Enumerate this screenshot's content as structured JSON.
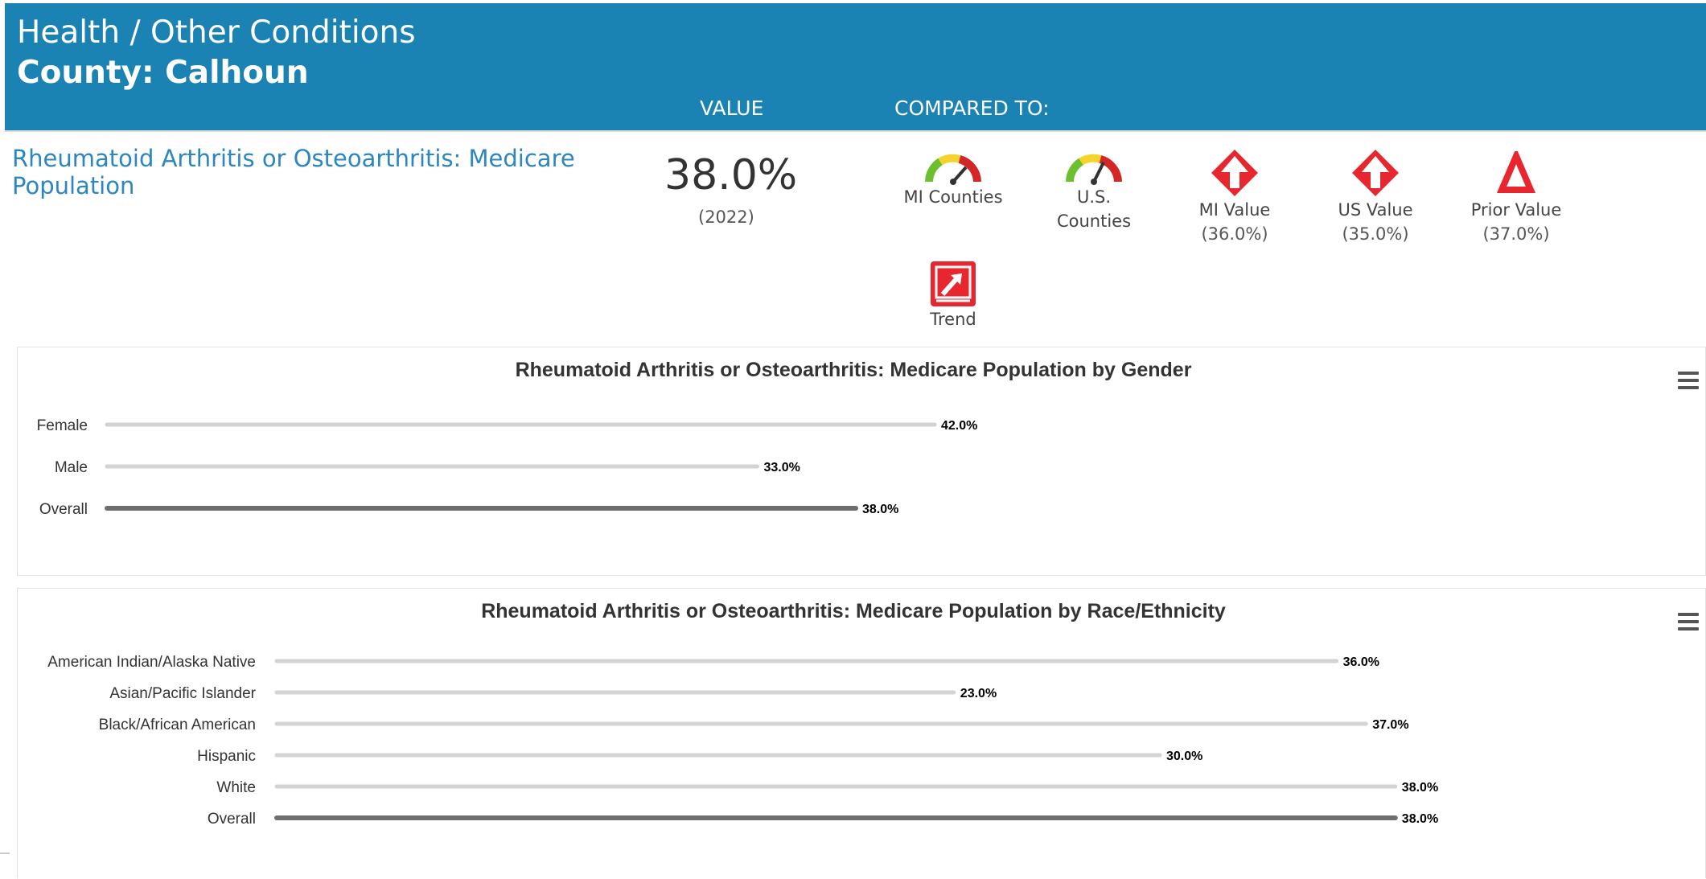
{
  "header": {
    "breadcrumb": "Health / Other Conditions",
    "county": "County: Calhoun",
    "value_col": "VALUE",
    "compared_col": "COMPARED TO:"
  },
  "indicator": {
    "name": "Rheumatoid Arthritis or Osteoarthritis: Medicare Population",
    "value": "38.0%",
    "year": "(2022)"
  },
  "comparisons": [
    {
      "label": "MI Counties",
      "icon": "gauge-icon"
    },
    {
      "label": "U.S. Counties",
      "icon": "gauge-icon"
    },
    {
      "label": "MI Value",
      "sub": "(36.0%)",
      "icon": "up-arrow-diamond-icon"
    },
    {
      "label": "US Value",
      "sub": "(35.0%)",
      "icon": "up-arrow-diamond-icon"
    },
    {
      "label": "Prior Value",
      "sub": "(37.0%)",
      "icon": "delta-triangle-icon"
    },
    {
      "label": "Trend",
      "icon": "trend-up-icon"
    }
  ],
  "colors": {
    "header_bg": "#1b82b4",
    "link": "#2c86c0",
    "alert_red": "#e8262f",
    "bar_light": "#d3d3d3",
    "bar_overall": "#6e6e6e"
  },
  "chart_data": [
    {
      "type": "bar",
      "orientation": "horizontal",
      "title": "Rheumatoid Arthritis or Osteoarthritis: Medicare Population by Gender",
      "categories": [
        "Female",
        "Male",
        "Overall"
      ],
      "values": [
        42.0,
        33.0,
        38.0
      ],
      "value_labels": [
        "42.0%",
        "33.0%",
        "38.0%"
      ],
      "highlight": "Overall",
      "grid": false,
      "legend": false
    },
    {
      "type": "bar",
      "orientation": "horizontal",
      "title": "Rheumatoid Arthritis or Osteoarthritis: Medicare Population by Race/Ethnicity",
      "categories": [
        "American Indian/Alaska Native",
        "Asian/Pacific Islander",
        "Black/African American",
        "Hispanic",
        "White",
        "Overall"
      ],
      "values": [
        36.0,
        23.0,
        37.0,
        30.0,
        38.0,
        38.0
      ],
      "value_labels": [
        "36.0%",
        "23.0%",
        "37.0%",
        "30.0%",
        "38.0%",
        "38.0%"
      ],
      "highlight": "Overall",
      "grid": false,
      "legend": false
    }
  ]
}
